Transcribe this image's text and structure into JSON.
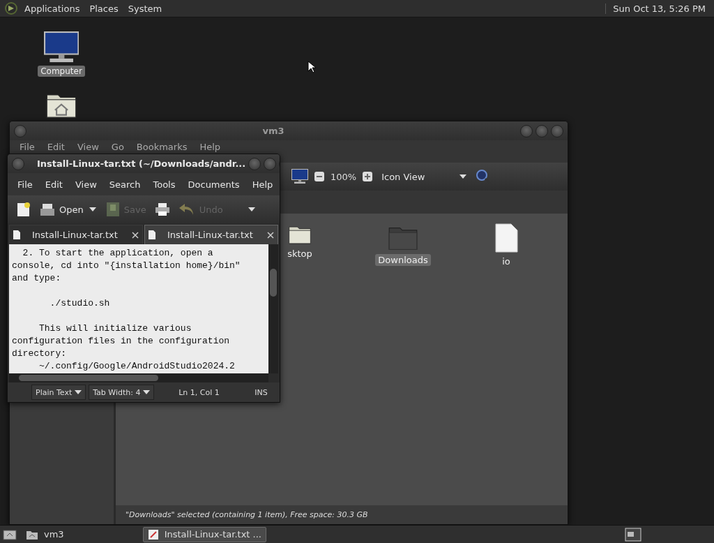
{
  "top_panel": {
    "menus": [
      "Applications",
      "Places",
      "System"
    ],
    "clock": "Sun Oct 13,  5:26 PM"
  },
  "desktop_icons": [
    {
      "kind": "computer",
      "label": "Computer",
      "selected": true
    },
    {
      "kind": "home"
    }
  ],
  "file_manager": {
    "title": "vm3",
    "menu": [
      "File",
      "Edit",
      "View",
      "Go",
      "Bookmarks",
      "Help"
    ],
    "zoom": "100%",
    "view": "Icon View",
    "items": [
      {
        "kind": "folder",
        "label": "sktop",
        "selected": false
      },
      {
        "kind": "folder",
        "label": "Downloads",
        "selected": true
      },
      {
        "kind": "file",
        "label": "io",
        "selected": false
      }
    ],
    "status": "\"Downloads\" selected (containing 1 item), Free space: 30.3 GB"
  },
  "editor": {
    "title": "Install-Linux-tar.txt (~/Downloads/andr...",
    "menu": [
      "File",
      "Edit",
      "View",
      "Search",
      "Tools",
      "Documents",
      "Help"
    ],
    "toolbar": [
      {
        "kind": "new",
        "disabled": false
      },
      {
        "kind": "open",
        "label": "Open",
        "disabled": false
      },
      {
        "kind": "save",
        "label": "Save",
        "disabled": true
      },
      {
        "kind": "print",
        "disabled": false
      },
      {
        "kind": "undo",
        "label": "Undo",
        "disabled": true
      }
    ],
    "tabs": [
      {
        "label": "Install-Linux-tar.txt",
        "selected": false
      },
      {
        "label": "Install-Linux-tar.txt",
        "selected": true
      }
    ],
    "blocks": [
      [
        "  2. To start the application, open a",
        "console, cd into \"{installation home}/bin\"",
        "and type:"
      ],
      [
        "       ./studio.sh"
      ],
      [
        "     This will initialize various",
        "configuration files in the configuration",
        "directory:",
        "     ~/.config/Google/AndroidStudio2024.2"
      ]
    ],
    "status": {
      "language": "Plain Text",
      "tab_width": "Tab Width:  4",
      "position": "Ln 1, Col 1",
      "mode": "INS"
    }
  },
  "taskbar": {
    "tasks": [
      {
        "kind": "folder",
        "label": "vm3",
        "selected": false
      },
      {
        "kind": "editor",
        "label": "Install-Linux-tar.txt ...",
        "selected": true
      }
    ]
  }
}
